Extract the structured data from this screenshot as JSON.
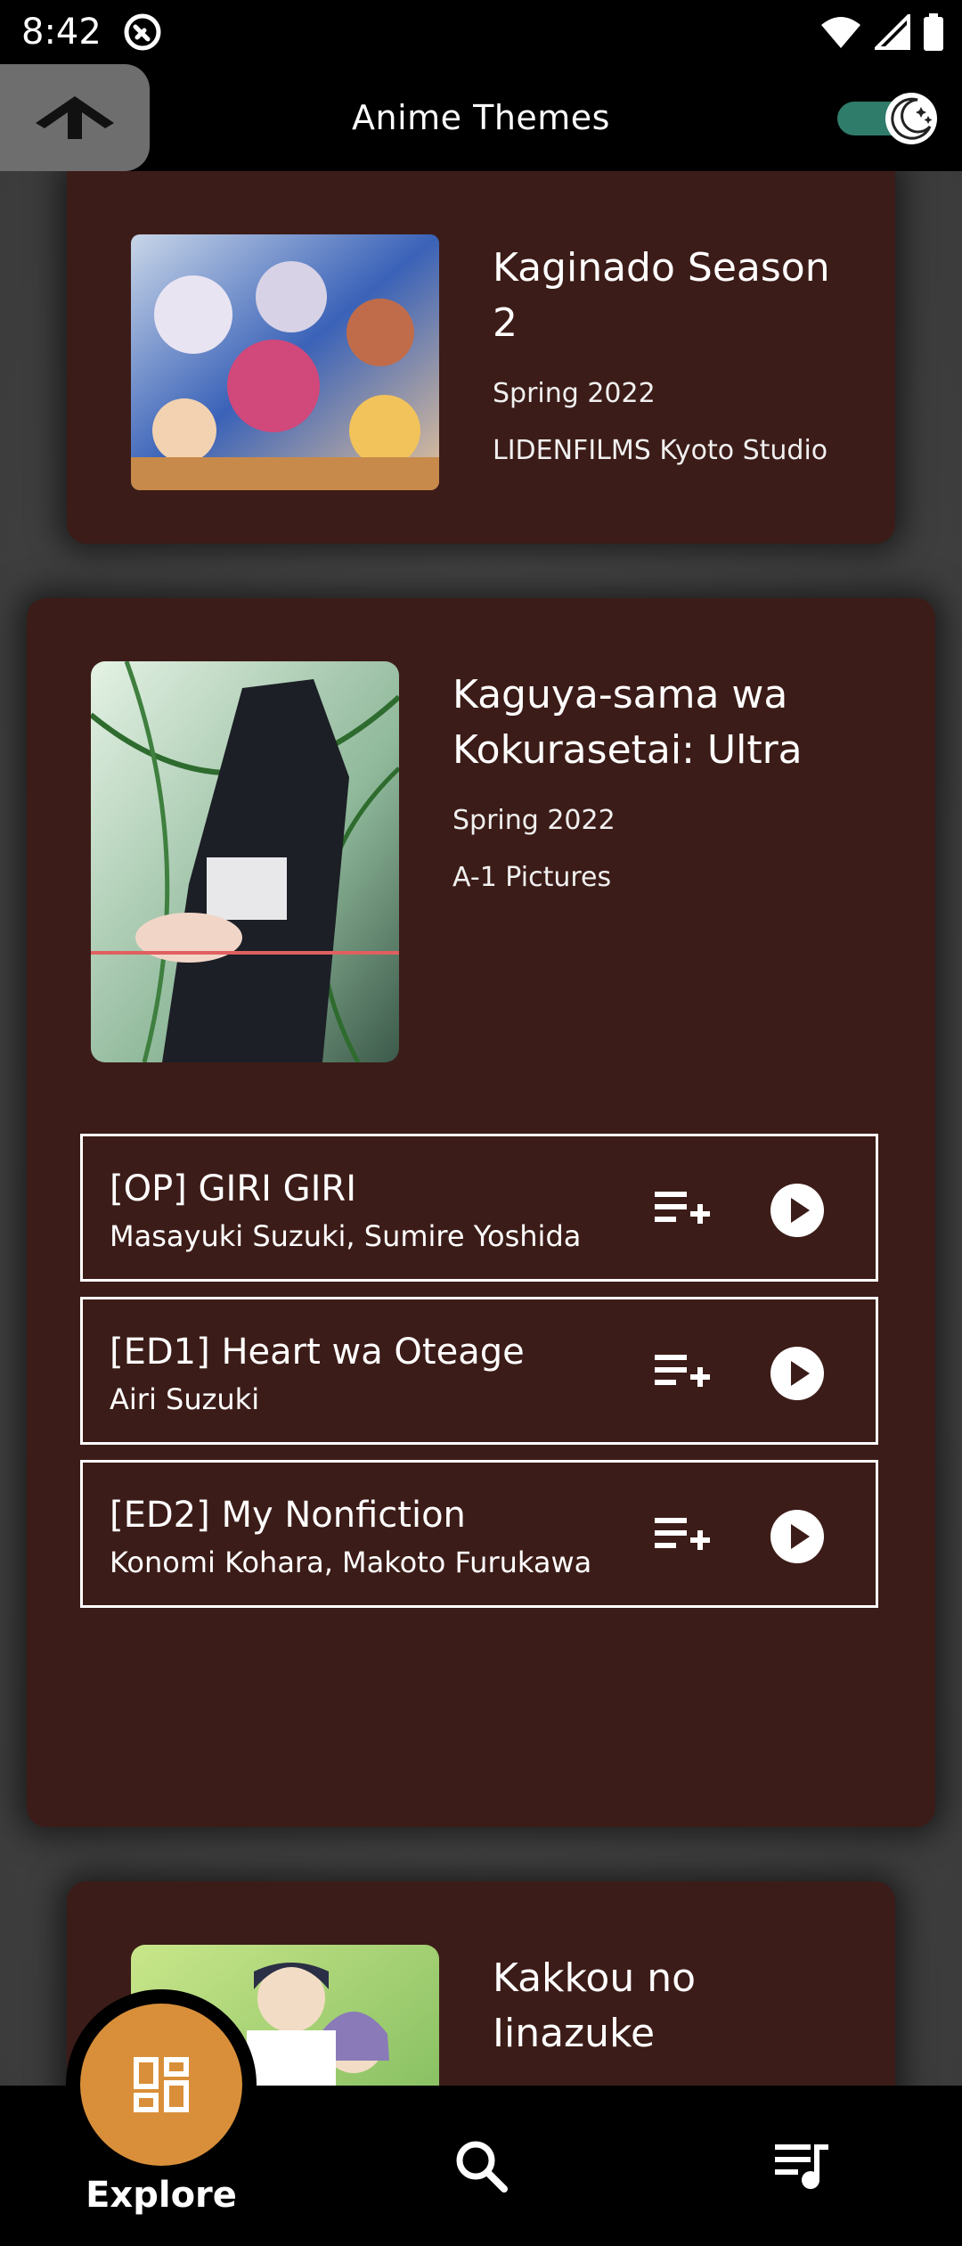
{
  "status_bar": {
    "time": "8:42"
  },
  "app_bar": {
    "title": "Anime Themes",
    "dark_mode_enabled": true
  },
  "anime": [
    {
      "title": "Kaginado Season 2",
      "season": "Spring 2022",
      "studio": "LIDENFILMS Kyoto Studio"
    },
    {
      "title": "Kaguya-sama wa Kokurasetai: Ultra",
      "season": "Spring 2022",
      "studio": "A-1 Pictures",
      "themes": [
        {
          "name": "[OP] GIRI GIRI",
          "artists": "Masayuki Suzuki, Sumire Yoshida"
        },
        {
          "name": "[ED1] Heart wa Oteage",
          "artists": "Airi Suzuki"
        },
        {
          "name": "[ED2] My Nonfiction",
          "artists": "Konomi Kohara, Makoto Furukawa"
        }
      ]
    },
    {
      "title": "Kakkou no Iinazuke"
    }
  ],
  "bottom_nav": {
    "items": [
      {
        "label": "Explore",
        "icon": "dashboard-icon",
        "active": true
      },
      {
        "icon": "search-icon"
      },
      {
        "icon": "playlist-icon"
      }
    ]
  },
  "colors": {
    "card_bg": "#3c1c18",
    "accent_fab": "#d98f3a",
    "toggle_track": "#2f7c6a"
  }
}
